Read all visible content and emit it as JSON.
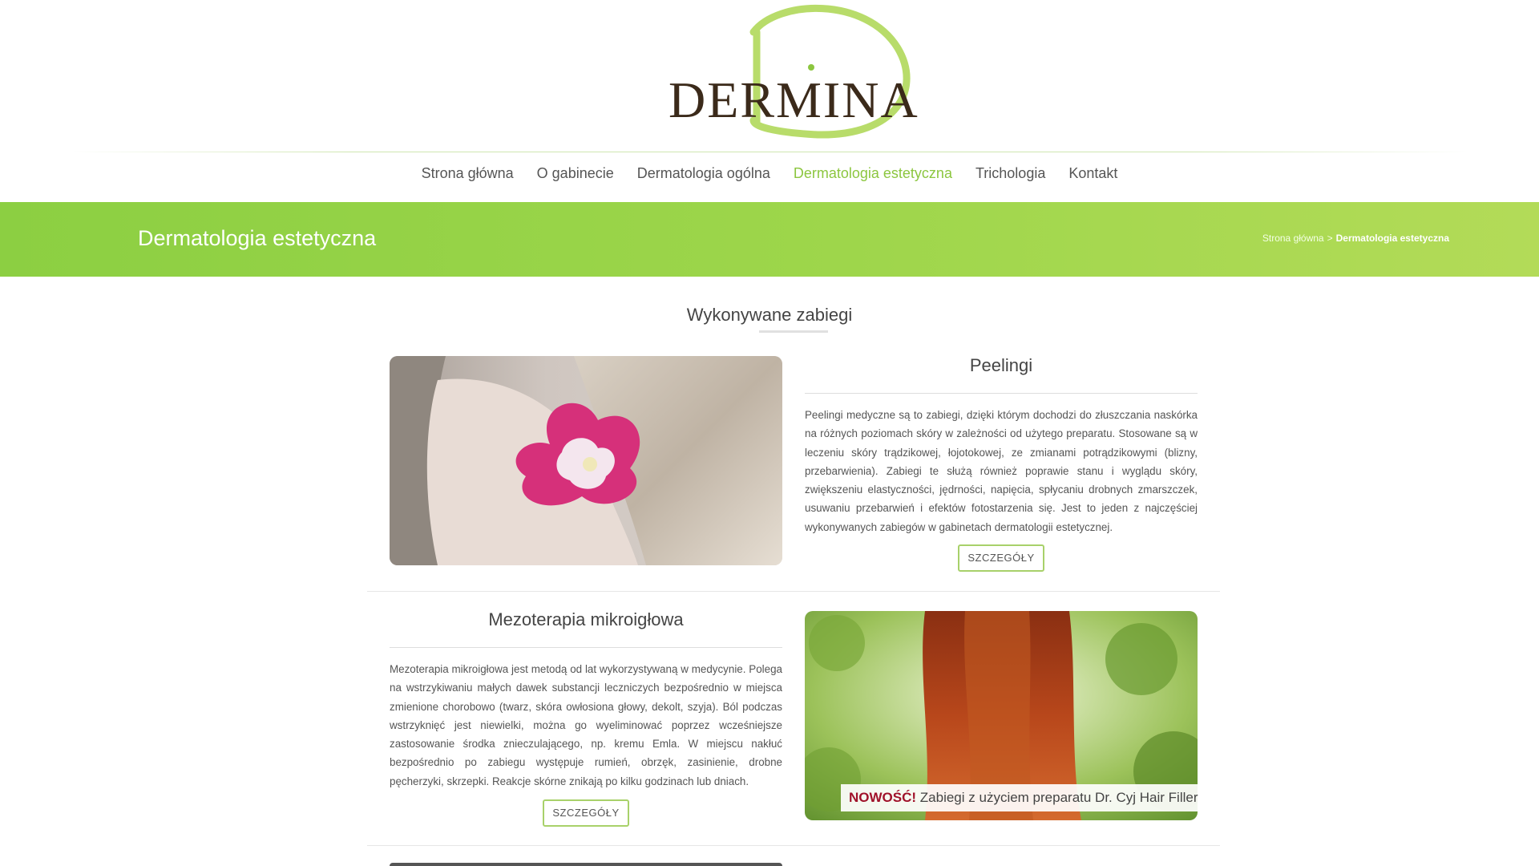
{
  "brand": {
    "logo_text": "DERMINA",
    "accent_color": "#8cc63f"
  },
  "nav": {
    "items": [
      {
        "label": "Strona główna",
        "active": false
      },
      {
        "label": "O gabinecie",
        "active": false
      },
      {
        "label": "Dermatologia ogólna",
        "active": false
      },
      {
        "label": "Dermatologia estetyczna",
        "active": true
      },
      {
        "label": "Trichologia",
        "active": false
      },
      {
        "label": "Kontakt",
        "active": false
      }
    ]
  },
  "banner": {
    "title": "Dermatologia estetyczna",
    "breadcrumb": {
      "home": "Strona główna",
      "separator": ">",
      "current": "Dermatologia estetyczna"
    }
  },
  "section": {
    "title": "Wykonywane zabiegi"
  },
  "treatments": [
    {
      "title": "Peelingi",
      "text": "Peelingi medyczne są to zabiegi, dzięki którym dochodzi do złuszczania naskórka na różnych poziomach skóry w zależności od użytego preparatu. Stosowane są w leczeniu skóry trądzikowej, łojotokowej, ze zmianami potrądzikowymi (blizny, przebarwienia). Zabiegi te służą również poprawie stanu i wyglądu skóry, zwiększeniu elastyczności, jędrności, napięcia, spłycaniu drobnych zmarszczek, usuwaniu przebarwień i efektów fotostarzenia się. Jest to jeden z najczęściej wykonywanych zabiegów w gabinetach dermatologii estetycznej.",
      "button": "SZCZEGÓŁY",
      "image": "woman-neck-tulip-photo"
    },
    {
      "title": "Mezoterapia mikroigłowa",
      "text": "Mezoterapia mikroigłowa jest metodą od lat wykorzystywaną w medycynie. Polega na wstrzykiwaniu małych dawek substancji leczniczych bezpośrednio w miejsca zmienione chorobowo (twarz, skóra owłosiona głowy, dekolt, szyja). Ból podczas wstrzyknięć jest niewielki, można go wyeliminować poprzez wcześniejsze zastosowanie środka znieczulającego, np. kremu Emla. W miejscu nakłuć bezpośrednio po zabiegu występuje rumień, obrzęk, zasinienie, drobne pęcherzyki, skrzepki. Reakcje skórne znikają po kilku godzinach lub dniach.",
      "button": "SZCZEGÓŁY",
      "image": "red-hair-woman-photo",
      "promo": {
        "highlight": "NOWOŚĆ!",
        "text": "Zabiegi z użyciem preparatu Dr. Cyj Hair Filler"
      }
    }
  ]
}
